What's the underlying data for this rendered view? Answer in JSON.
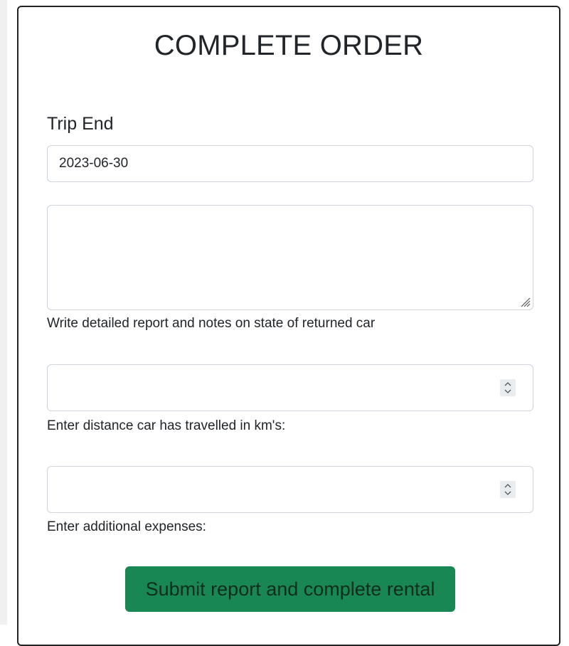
{
  "form": {
    "title": "COMPLETE ORDER",
    "trip_end_label": "Trip End",
    "trip_end_value": "2023-06-30",
    "report_value": "",
    "report_help": "Write detailed report and notes on state of returned car",
    "distance_value": "",
    "distance_help": "Enter distance car has travelled in km's:",
    "expenses_value": "",
    "expenses_help": "Enter additional expenses:",
    "submit_label": "Submit report and complete rental"
  },
  "colors": {
    "submit_bg": "#198754",
    "border": "#ced4da",
    "card_border": "#222222"
  },
  "icons": {
    "resize": "resize-grip-icon",
    "spinner": "number-spinner-icon"
  }
}
